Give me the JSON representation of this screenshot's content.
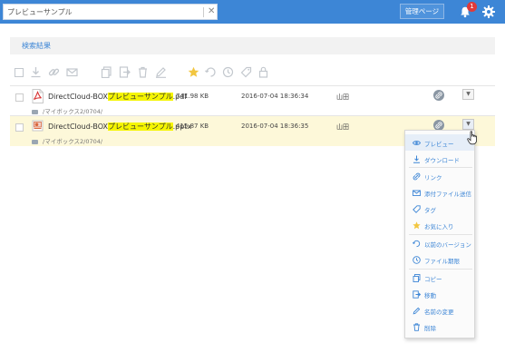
{
  "header": {
    "search_value": "プレビューサンプル",
    "clear_icon": "close-icon",
    "admin_label": "管理ページ",
    "notification_count": "1"
  },
  "section": {
    "title": "検索結果"
  },
  "files": [
    {
      "name_prefix": "DirectCloud-BOX",
      "name_highlight": "プレビューサンプル",
      "name_suffix": ".pdf",
      "path": "/マイボックス2/0704/",
      "size": "741.98 KB",
      "date": "2016-07-04 18:36:34",
      "owner": "山田",
      "icon": "pdf-file-icon"
    },
    {
      "name_prefix": "DirectCloud-BOX",
      "name_highlight": "プレビューサンプル",
      "name_suffix": ".pptx",
      "path": "/マイボックス2/0704/",
      "size": "415.87 KB",
      "date": "2016-07-04 18:36:35",
      "owner": "山田",
      "icon": "pptx-file-icon"
    }
  ],
  "context_menu": [
    {
      "label": "プレビュー",
      "icon": "eye-icon"
    },
    {
      "label": "ダウンロード",
      "icon": "download-icon"
    },
    {
      "label": "リンク",
      "icon": "link-icon"
    },
    {
      "label": "添付ファイル送信",
      "icon": "mail-icon"
    },
    {
      "label": "タグ",
      "icon": "tag-icon"
    },
    {
      "label": "お気に入り",
      "icon": "star-icon"
    },
    {
      "label": "以前のバージョン",
      "icon": "history-icon"
    },
    {
      "label": "ファイル期限",
      "icon": "clock-icon"
    },
    {
      "label": "コピー",
      "icon": "copy-icon"
    },
    {
      "label": "移動",
      "icon": "move-icon"
    },
    {
      "label": "名前の変更",
      "icon": "pencil-icon"
    },
    {
      "label": "削除",
      "icon": "trash-icon"
    }
  ],
  "colors": {
    "topbar": "#3d86d6",
    "highlight": "#f5f500",
    "selected_row": "#fdf8d9",
    "menu_text": "#3d86d6"
  }
}
